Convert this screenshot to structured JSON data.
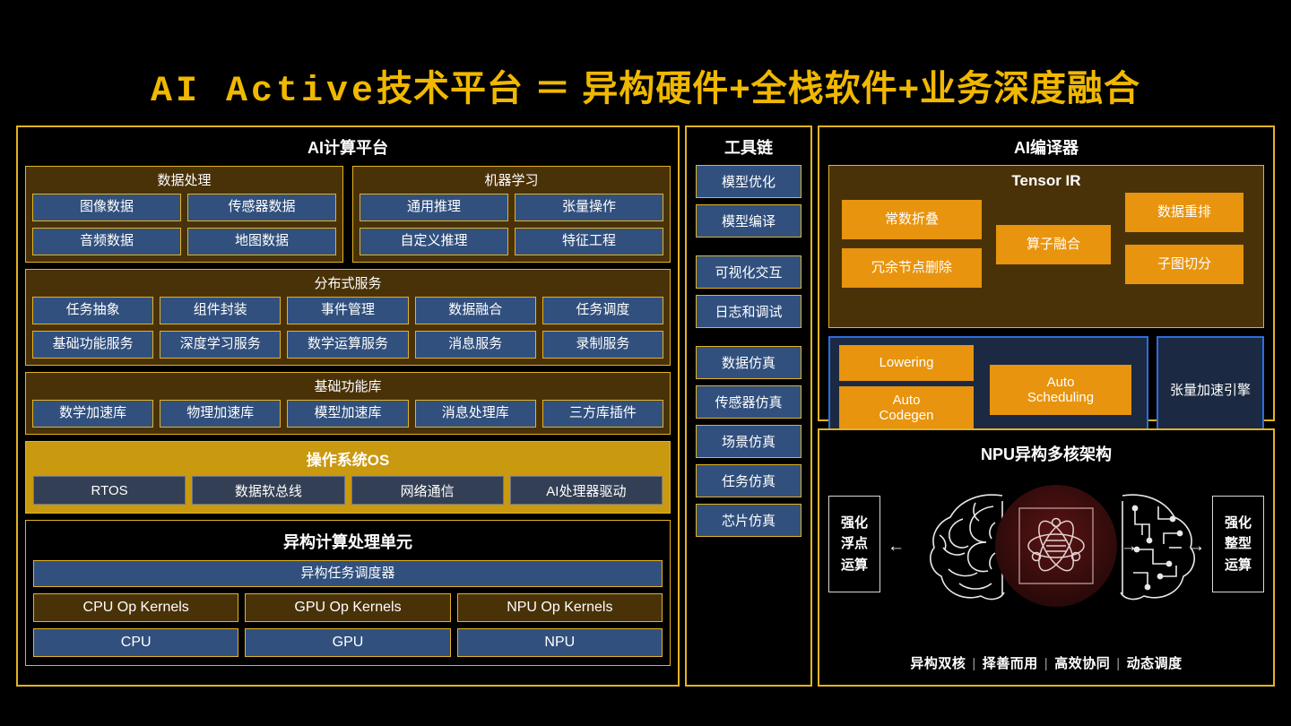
{
  "title": "AI Active技术平台 ＝ 异构硬件+全栈软件+业务深度融合",
  "colors": {
    "gold": "#e3b322",
    "title_gold": "#f0b800",
    "brown": "#4a3208",
    "blue": "#31507e",
    "orange": "#e8940e",
    "navy": "#1b2a42",
    "blue_border": "#2a6fe0",
    "os_band": "#c9990f",
    "slate": "#333f54",
    "background": "#000000"
  },
  "left_panel": {
    "heading": "AI计算平台",
    "groups": [
      {
        "title": "数据处理",
        "rows": [
          [
            "图像数据",
            "传感器数据"
          ],
          [
            "音频数据",
            "地图数据"
          ]
        ]
      },
      {
        "title": "机器学习",
        "rows": [
          [
            "通用推理",
            "张量操作"
          ],
          [
            "自定义推理",
            "特征工程"
          ]
        ]
      }
    ],
    "distributed": {
      "title": "分布式服务",
      "rows": [
        [
          "任务抽象",
          "组件封装",
          "事件管理",
          "数据融合",
          "任务调度"
        ],
        [
          "基础功能服务",
          "深度学习服务",
          "数学运算服务",
          "消息服务",
          "录制服务"
        ]
      ]
    },
    "base_lib": {
      "title": "基础功能库",
      "rows": [
        [
          "数学加速库",
          "物理加速库",
          "模型加速库",
          "消息处理库",
          "三方库插件"
        ]
      ]
    },
    "os": {
      "title": "操作系统OS",
      "items": [
        "RTOS",
        "数据软总线",
        "网络通信",
        "AI处理器驱动"
      ]
    },
    "hetero": {
      "title": "异构计算处理单元",
      "scheduler": "异构任务调度器",
      "kernels": [
        "CPU Op Kernels",
        "GPU Op Kernels",
        "NPU Op Kernels"
      ],
      "processors": [
        "CPU",
        "GPU",
        "NPU"
      ]
    }
  },
  "toolchain": {
    "heading": "工具链",
    "items": [
      "模型优化",
      "模型编译",
      "可视化交互",
      "日志和调试",
      "数据仿真",
      "传感器仿真",
      "场景仿真",
      "任务仿真",
      "芯片仿真"
    ]
  },
  "compiler": {
    "heading": "AI编译器",
    "tensor_ir": {
      "title": "Tensor IR",
      "items": [
        "常数折叠",
        "冗余节点删除",
        "算子融合",
        "数据重排",
        "子图切分"
      ]
    },
    "lowering": {
      "items": [
        "Lowering",
        "Auto Codegen",
        "Auto Scheduling"
      ],
      "accel_engine": "张量加速引擎"
    }
  },
  "npu": {
    "heading": "NPU异构多核架构",
    "left_box": [
      "强化",
      "浮点",
      "运算"
    ],
    "right_box": [
      "强化",
      "整型",
      "运算"
    ],
    "tagline": [
      "异构双核",
      "择善而用",
      "高效协同",
      "动态调度"
    ],
    "icons": {
      "left": "brain-organic-icon",
      "center": "atom-icon",
      "right": "brain-circuit-icon"
    }
  }
}
